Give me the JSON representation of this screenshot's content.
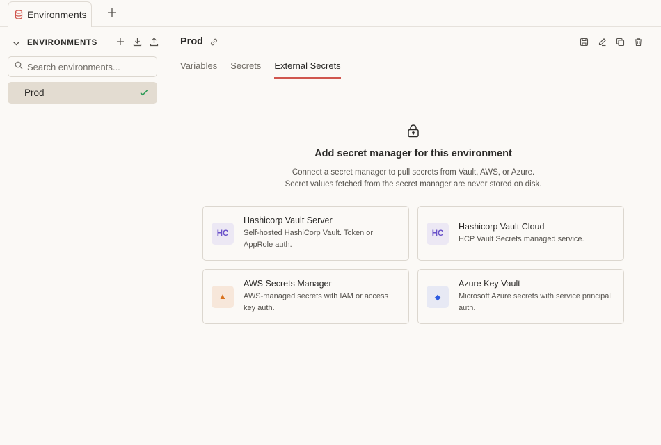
{
  "tabbar": {
    "tab_label": "Environments"
  },
  "sidebar": {
    "title": "ENVIRONMENTS",
    "search_placeholder": "Search environments...",
    "items": [
      {
        "label": "Prod",
        "selected": true
      }
    ]
  },
  "main": {
    "title": "Prod",
    "tabs": [
      {
        "label": "Variables",
        "active": false
      },
      {
        "label": "Secrets",
        "active": false
      },
      {
        "label": "External Secrets",
        "active": true
      }
    ],
    "empty_state": {
      "title": "Add secret manager for this environment",
      "description_line1": "Connect a secret manager to pull secrets from Vault, AWS, or Azure.",
      "description_line2": "Secret values fetched from the secret manager are never stored on disk."
    },
    "providers": [
      {
        "badge": "HC",
        "title": "Hashicorp Vault Server",
        "desc": "Self-hosted HashiCorp Vault. Token or AppRole auth.",
        "icon": "hashicorp-icon"
      },
      {
        "badge": "HC",
        "title": "Hashicorp Vault Cloud",
        "desc": "HCP Vault Secrets managed service.",
        "icon": "hashicorp-icon"
      },
      {
        "badge": "▲",
        "title": "AWS Secrets Manager",
        "desc": "AWS-managed secrets with IAM or access key auth.",
        "icon": "aws-icon"
      },
      {
        "badge": "◆",
        "title": "Azure Key Vault",
        "desc": "Microsoft Azure secrets with service principal auth.",
        "icon": "azure-icon"
      }
    ]
  },
  "colors": {
    "background": "#fbf9f6",
    "accent_underline": "#d0564e",
    "selected_item": "#e3dcd1",
    "check_green": "#2e9b57"
  }
}
